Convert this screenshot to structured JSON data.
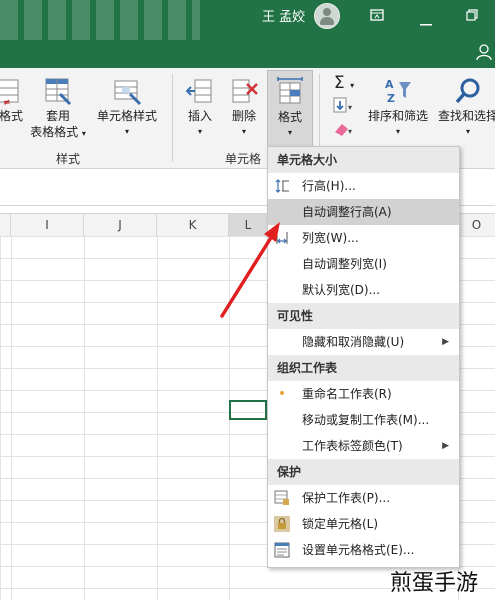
{
  "titlebar": {
    "user_name": "王 孟姣",
    "icons": [
      "avatar-icon",
      "ribbon-display-icon",
      "minimize-icon",
      "restore-icon",
      "share-icon"
    ]
  },
  "ribbon": {
    "buttons": {
      "format_as_table_partial": "格式",
      "table_styles": "套用",
      "table_styles_2": "表格格式",
      "cell_styles": "单元格样式",
      "insert": "插入",
      "delete": "删除",
      "format": "格式",
      "sort_filter": "排序和筛选",
      "find_select": "查找和选择"
    },
    "groups": {
      "styles": "样式",
      "cells": "单元格"
    }
  },
  "sheet": {
    "columns": [
      "I",
      "J",
      "K",
      "L",
      "O"
    ]
  },
  "format_menu": {
    "sections": {
      "cell_size": "单元格大小",
      "visibility": "可见性",
      "organize_sheets": "组织工作表",
      "protection": "保护"
    },
    "items": {
      "row_height": "行高(H)...",
      "autofit_row_height": "自动调整行高(A)",
      "column_width": "列宽(W)...",
      "autofit_column_width": "自动调整列宽(I)",
      "default_width": "默认列宽(D)...",
      "hide_unhide": "隐藏和取消隐藏(U)",
      "rename_sheet": "重命名工作表(R)",
      "move_copy_sheet": "移动或复制工作表(M)...",
      "tab_color": "工作表标签颜色(T)",
      "protect_sheet": "保护工作表(P)...",
      "lock_cell": "锁定单元格(L)",
      "format_cells": "设置单元格格式(E)..."
    }
  },
  "watermark": "煎蛋手游",
  "colors": {
    "excel_green": "#217346",
    "menu_highlight": "#d2d2d2",
    "arrow": "#e02020"
  }
}
